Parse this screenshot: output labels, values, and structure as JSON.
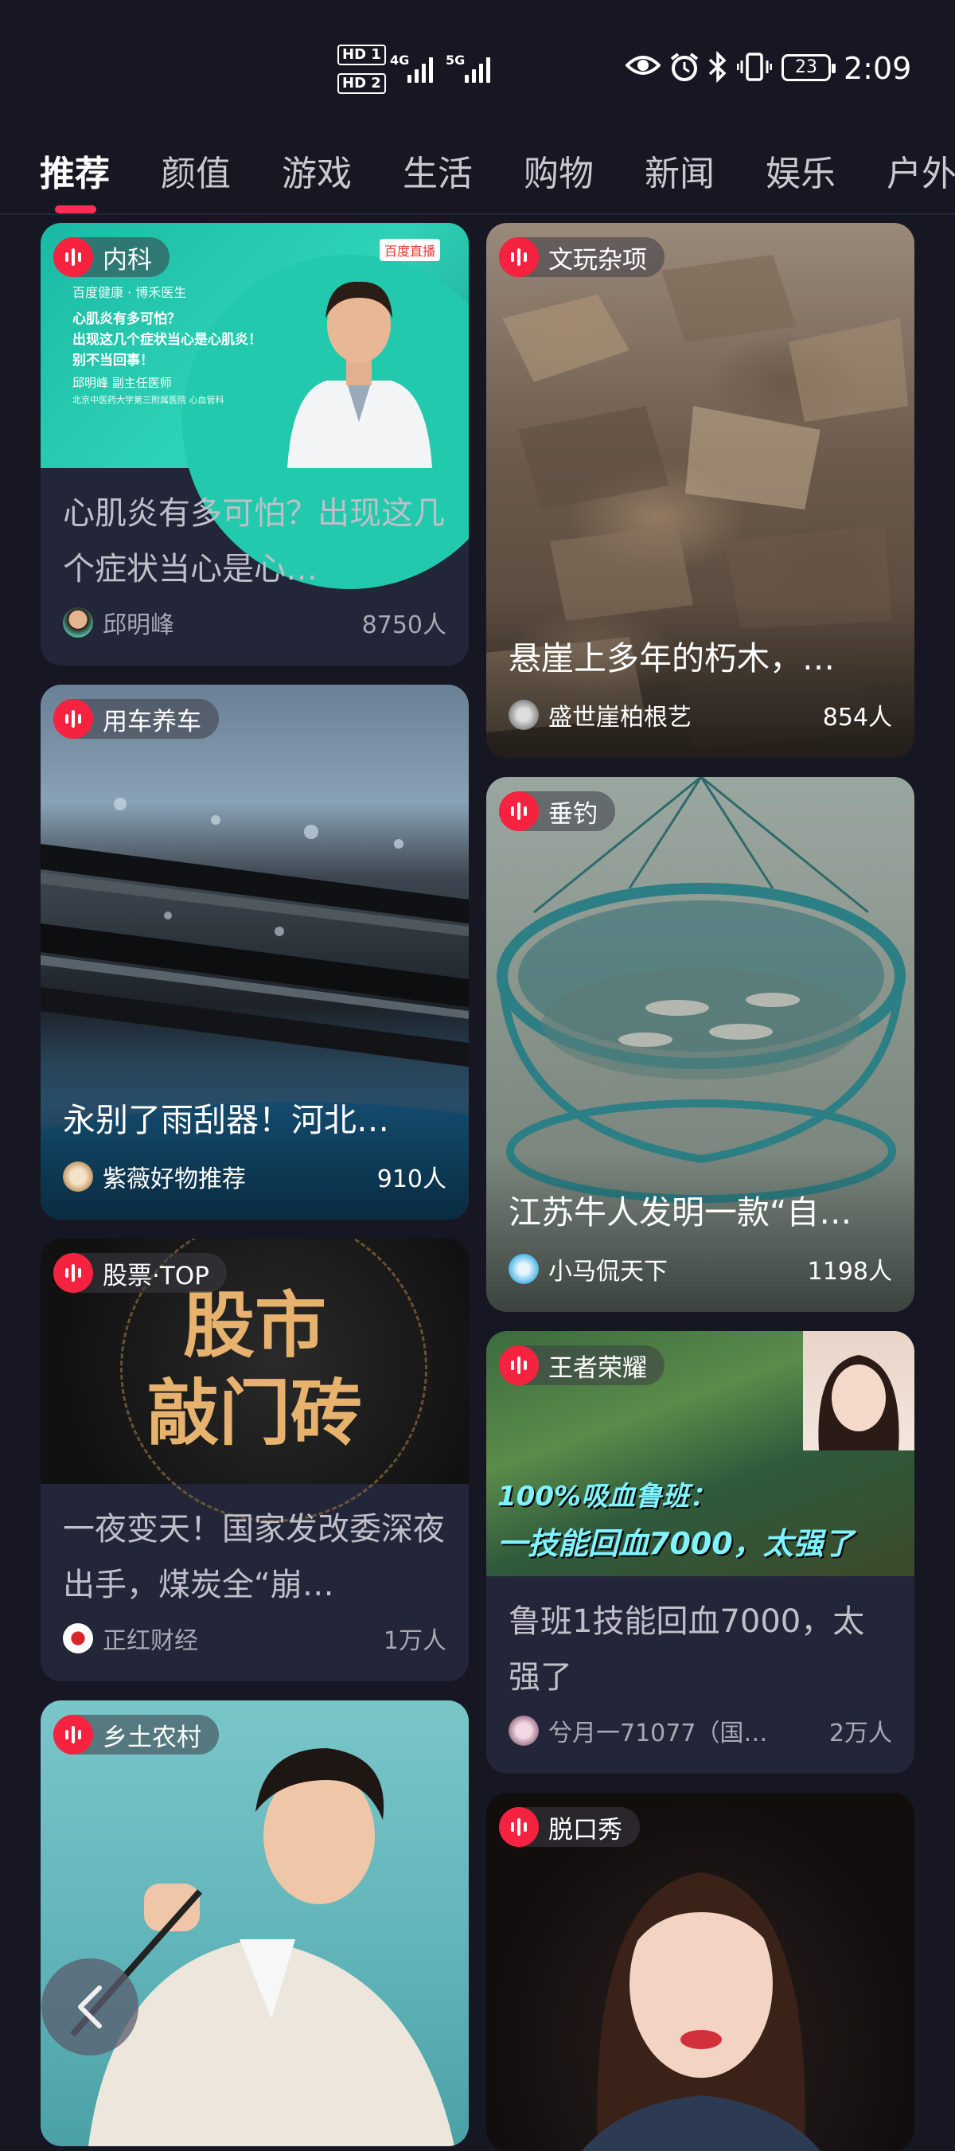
{
  "status": {
    "hd1": "HD 1",
    "hd2": "HD 2",
    "net1": "4G",
    "net2": "5G",
    "battery": "23",
    "time": "2:09",
    "icons": [
      "eye-icon",
      "alarm-icon",
      "bluetooth-icon",
      "vibrate-icon"
    ]
  },
  "tabs": [
    "推荐",
    "颜值",
    "游戏",
    "生活",
    "购物",
    "新闻",
    "娱乐",
    "户外"
  ],
  "active_tab": "推荐",
  "accent": "#ff2d55",
  "cards": {
    "c1": {
      "tag": "内科",
      "title": "心肌炎有多可怕？出现这几个症状当心是心…",
      "author": "邱明峰",
      "count": "8750人",
      "poster": {
        "brand": "百度直播",
        "partners": "百度健康 · 博禾医生",
        "lines": [
          "心肌炎有多可怕？",
          "出现这几个症状当心是心肌炎！",
          "别不当回事！"
        ],
        "doctor": "邱明峰  副主任医师",
        "hospital": "北京中医药大学第三附属医院 心血管科"
      }
    },
    "c2": {
      "tag": "文玩杂项",
      "title": "悬崖上多年的朽木，…",
      "author": "盛世崖柏根艺",
      "count": "854人"
    },
    "c3": {
      "tag": "用车养车",
      "title": "永别了雨刮器！河北…",
      "author": "紫薇好物推荐",
      "count": "910人"
    },
    "c4": {
      "tag": "垂钓",
      "title": "江苏牛人发明一款“自…",
      "author": "小马侃天下",
      "count": "1198人"
    },
    "c5": {
      "tag": "股票·TOP",
      "title": "一夜变天！国家发改委深夜出手，煤炭全“崩…",
      "author": "正红财经",
      "count": "1万人",
      "poster": {
        "line1": "股市",
        "line2": "敲门砖"
      }
    },
    "c6": {
      "tag": "王者荣耀",
      "title": "鲁班1技能回血7000，太强了",
      "author": "兮月一71077（国…",
      "count": "2万人",
      "poster": {
        "line1": "100%吸血鲁班：",
        "line2": "一技能回血7000，太强了"
      }
    },
    "c7": {
      "tag": "乡土农村"
    },
    "c8": {
      "tag": "脱口秀"
    }
  }
}
